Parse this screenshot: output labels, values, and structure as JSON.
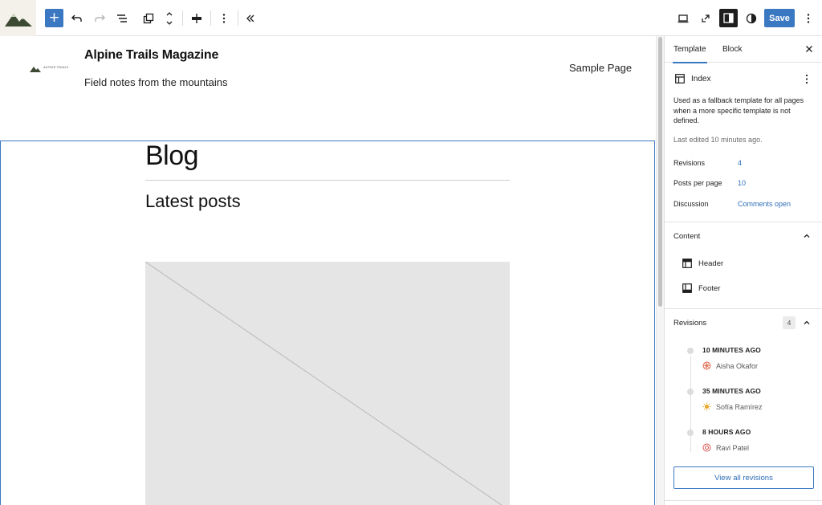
{
  "toolbar": {
    "add_icon": "+",
    "undo_icon": "undo-icon",
    "redo_icon": "redo-icon",
    "list_view_icon": "list-view-icon",
    "save_label": "Save"
  },
  "site": {
    "logo_text": "ALPINE TRAILS",
    "title": "Alpine Trails Magazine",
    "tagline": "Field notes from the mountains",
    "nav_link": "Sample Page"
  },
  "content": {
    "blog_heading": "Blog",
    "latest_heading": "Latest posts"
  },
  "sidebar": {
    "tabs": [
      {
        "label": "Template"
      },
      {
        "label": "Block"
      }
    ],
    "template": {
      "name": "Index",
      "description": "Used as a fallback template for all pages when a more specific template is not defined.",
      "last_edited": "Last edited 10 minutes ago."
    },
    "details": [
      {
        "label": "Revisions",
        "value": "4"
      },
      {
        "label": "Posts per page",
        "value": "10"
      },
      {
        "label": "Discussion",
        "value": "Comments open"
      }
    ],
    "content_section": {
      "heading": "Content",
      "items": [
        {
          "label": "Header",
          "icon": "header-icon"
        },
        {
          "label": "Footer",
          "icon": "footer-icon"
        }
      ]
    },
    "revisions_section": {
      "heading": "Revisions",
      "count": "4",
      "items": [
        {
          "time": "10 MINUTES AGO",
          "author": "Aisha Okafor"
        },
        {
          "time": "35 MINUTES AGO",
          "author": "Sofía Ramírez"
        },
        {
          "time": "8 HOURS AGO",
          "author": "Ravi Patel"
        }
      ],
      "view_all_label": "View all revisions"
    }
  },
  "colors": {
    "accent": "#3b78c2",
    "link": "#2f6fb8"
  }
}
